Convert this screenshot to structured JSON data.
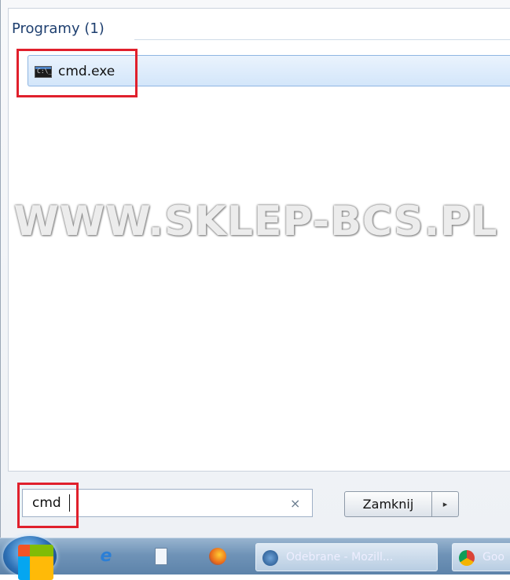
{
  "results": {
    "group_header": "Programy (1)",
    "items": [
      {
        "label": "cmd.exe",
        "icon": "cmd-icon"
      }
    ]
  },
  "watermark": "WWW.SKLEP-BCS.PL",
  "search": {
    "value": "cmd",
    "clear_icon": "×"
  },
  "shutdown": {
    "label": "Zamknij",
    "arrow": "▸"
  },
  "taskbar": {
    "pinned": [
      {
        "name": "internet-explorer-icon"
      },
      {
        "name": "document-icon"
      },
      {
        "name": "firefox-icon"
      }
    ],
    "tasks": [
      {
        "label": "Odebrane - Mozill...",
        "icon": "thunderbird-icon"
      },
      {
        "label": "Goo",
        "icon": "chrome-icon"
      }
    ]
  },
  "colors": {
    "highlight_box": "#e0202c",
    "selection": "#d3e6fa"
  }
}
